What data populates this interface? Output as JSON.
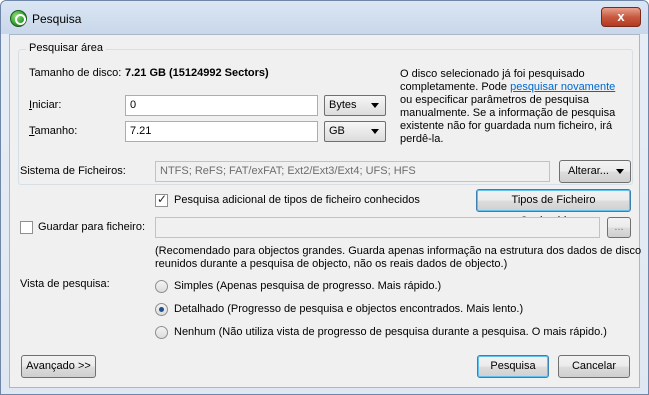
{
  "window": {
    "title": "Pesquisa",
    "close_glyph": "x"
  },
  "search_area": {
    "group_title": "Pesquisar área",
    "disk_size_label": "Tamanho de disco:",
    "disk_size_value": "7.21 GB (15124992 Sectors)",
    "start_label": "Iniciar:",
    "start_value": "0",
    "start_unit": "Bytes",
    "size_label": "Tamanho:",
    "size_value": "7.21",
    "size_unit": "GB",
    "info_line1": "O disco selecionado já foi pesquisado",
    "info_line2_prefix": "completamente. Pode ",
    "info_link": "pesquisar novamente",
    "info_line3": "ou especificar parâmetros de pesquisa",
    "info_line4": "manualmente. Se a informação de pesquisa",
    "info_line5": "existente não for guardada num ficheiro, irá",
    "info_line6": "perdê-la."
  },
  "filesystem": {
    "label": "Sistema de Ficheiros:",
    "value": "NTFS; ReFS; FAT/exFAT; Ext2/Ext3/Ext4; UFS; HFS",
    "change_button": "Alterar...",
    "extra_search_label": "Pesquisa adicional de tipos de ficheiro conhecidos",
    "extra_search_checked": true,
    "known_types_button": "Tipos de Ficheiro Conhecidos..."
  },
  "save": {
    "label": "Guardar para ficheiro:",
    "checked": false,
    "path_value": "",
    "browse_button": "...",
    "note_line1": "(Recomendado para objectos grandes. Guarda apenas informação na estrutura dos dados de disco",
    "note_line2": "reunidos durante a pesquisa de objecto, não os reais dados de objecto.)"
  },
  "view": {
    "label": "Vista de pesquisa:",
    "options": [
      {
        "label": "Simples (Apenas pesquisa de progresso. Mais rápido.)",
        "selected": false
      },
      {
        "label": "Detalhado (Progresso de pesquisa e objectos encontrados. Mais lento.)",
        "selected": true
      },
      {
        "label": "Nenhum (Não utiliza vista de progresso de pesquisa durante a pesquisa. O mais rápido.)",
        "selected": false
      }
    ]
  },
  "footer": {
    "advanced_button": "Avançado >>",
    "search_button": "Pesquisa",
    "cancel_button": "Cancelar"
  },
  "colors": {
    "link": "#0066cc",
    "close_button": "#c75a41",
    "default_button_border": "#3c7fb1"
  }
}
